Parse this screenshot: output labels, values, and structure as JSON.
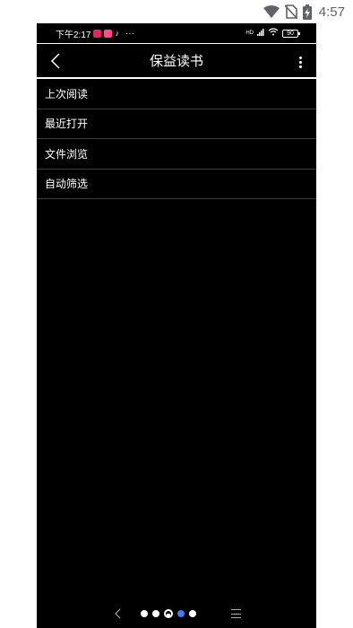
{
  "outer_status": {
    "time": "4:57"
  },
  "inner_status": {
    "time": "下午2:17",
    "overflow": "···",
    "battery": "90",
    "network": "HD"
  },
  "header": {
    "title": "保益读书"
  },
  "menu": {
    "items": [
      {
        "label": "上次阅读"
      },
      {
        "label": "最近打开"
      },
      {
        "label": "文件浏览"
      },
      {
        "label": "自动筛选"
      }
    ]
  },
  "colors": {
    "background": "#000000",
    "text": "#ffffff",
    "divider": "#3a3a3a",
    "nav_active": "#3d7bf7"
  }
}
